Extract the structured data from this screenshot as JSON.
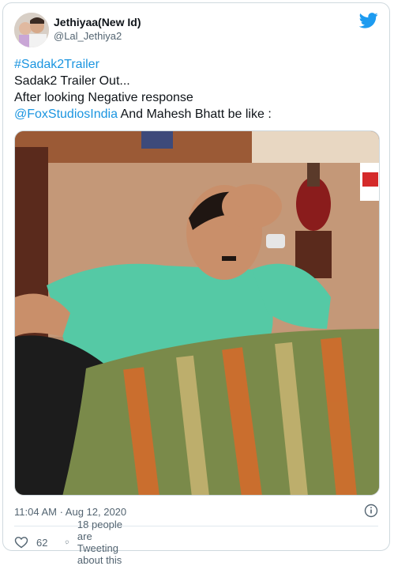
{
  "user": {
    "display_name": "Jethiyaa(New Id)",
    "handle": "@Lal_Jethiya2"
  },
  "tweet": {
    "hashtag": "#Sadak2Trailer",
    "line1": "Sadak2 Trailer Out...",
    "line2": "After looking Negative response",
    "mention": "@FoxStudiosIndia",
    "line3_rest": " And Mahesh Bhatt be like :"
  },
  "timestamp": "11:04 AM · Aug 12, 2020",
  "actions": {
    "like_count": "62",
    "conversation_label": "18 people are Tweeting about this"
  },
  "media": {
    "alt": "man lying on bed holding his head"
  },
  "colors": {
    "link": "#1b95e0",
    "twitter_blue": "#1d9bf0",
    "secondary_text": "#536471"
  }
}
